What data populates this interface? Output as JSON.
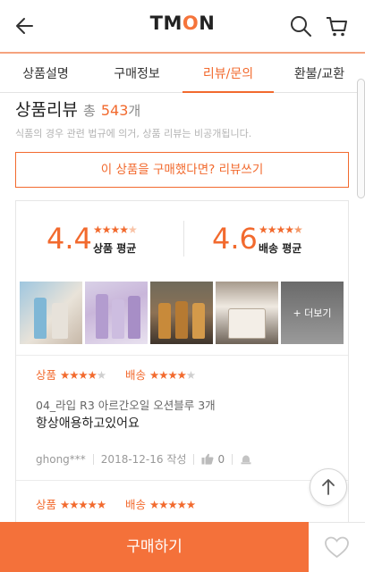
{
  "header": {
    "logo_text_before": "TM",
    "logo_text_accent": "O",
    "logo_text_after": "N",
    "accent_color": "#f26a2e"
  },
  "tabs": [
    {
      "label": "상품설명",
      "active": false
    },
    {
      "label": "구매정보",
      "active": false
    },
    {
      "label": "리뷰/문의",
      "active": true
    },
    {
      "label": "환불/교환",
      "active": false
    }
  ],
  "reviews": {
    "title": "상품리뷰",
    "total_prefix": "총",
    "count": "543",
    "count_unit": "개",
    "notice": "식품의 경우 관련 법규에 의거, 상품 리뷰는 비공개됩니다.",
    "write_button": "이 상품을 구매했다면? 리뷰쓰기"
  },
  "summary": {
    "product_score": "4.4",
    "product_label": "상품 평균",
    "product_stars": 4.4,
    "delivery_score": "4.6",
    "delivery_label": "배송 평균",
    "delivery_stars": 4.6,
    "more_label": "+ 더보기"
  },
  "review_items": [
    {
      "product_label": "상품",
      "product_stars": 4,
      "delivery_label": "배송",
      "delivery_stars": 4,
      "option": "04_라입 R3 아르간오일 오션블루 3개",
      "text": "항상애용하고있어요",
      "user": "ghong***",
      "date": "2018-12-16 작성",
      "likes": "0"
    },
    {
      "product_label": "상품",
      "product_stars": 5,
      "delivery_label": "배송",
      "delivery_stars": 5
    }
  ],
  "bottom": {
    "buy_label": "구매하기"
  }
}
